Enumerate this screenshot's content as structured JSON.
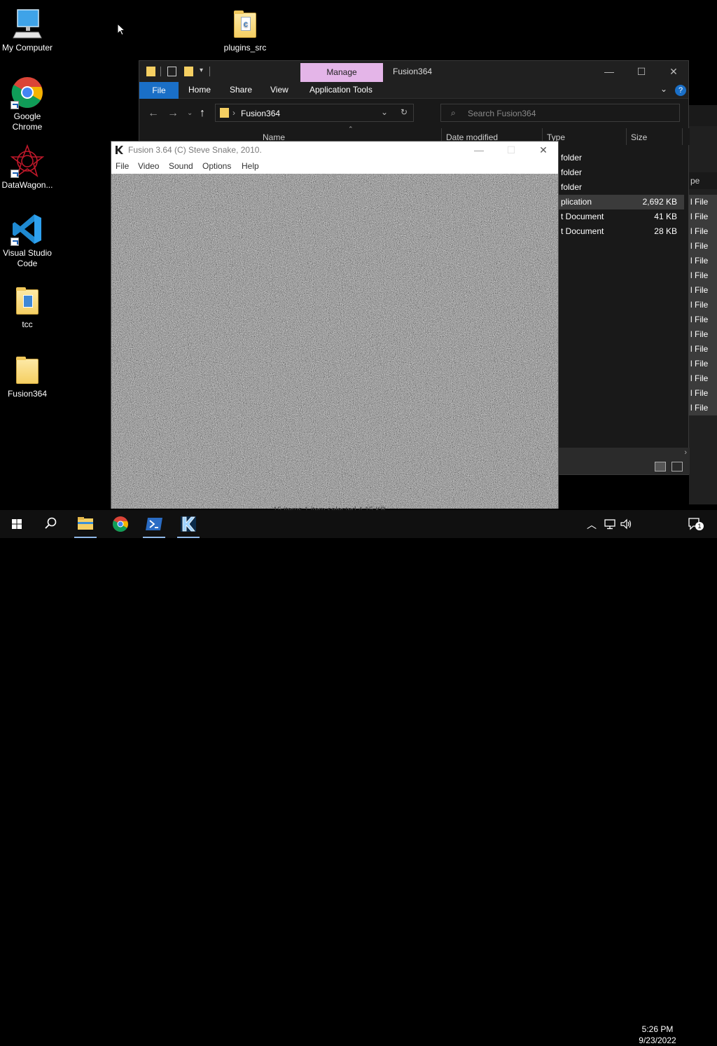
{
  "desktop": {
    "icons": [
      {
        "label": "My Computer"
      },
      {
        "label": "Google Chrome"
      },
      {
        "label": "DataWagon..."
      },
      {
        "label": "Visual Studio Code"
      },
      {
        "label": "tcc"
      },
      {
        "label": "Fusion364"
      },
      {
        "label": "plugins_src"
      }
    ]
  },
  "explorer": {
    "manage_tab": "Manage",
    "title": "Fusion364",
    "ribbon": {
      "file": "File",
      "home": "Home",
      "share": "Share",
      "view": "View",
      "app_tools": "Application Tools"
    },
    "address": "Fusion364",
    "search_placeholder": "Search Fusion364",
    "columns": {
      "name": "Name",
      "date": "Date modified",
      "type": "Type",
      "size": "Size"
    },
    "rows": [
      {
        "type": "folder",
        "size": ""
      },
      {
        "type": "folder",
        "size": ""
      },
      {
        "type": "folder",
        "size": ""
      },
      {
        "type": "plication",
        "size": "2,692 KB"
      },
      {
        "type": "t Document",
        "size": "41 KB"
      },
      {
        "type": "t Document",
        "size": "28 KB"
      }
    ]
  },
  "third_window": {
    "header": "pe",
    "row_label": "l File"
  },
  "fusion": {
    "title": "Fusion 3.64 (C) Steve Snake, 2010.",
    "menu": {
      "file": "File",
      "video": "Video",
      "sound": "Sound",
      "options": "Options",
      "help": "Help"
    }
  },
  "taskbar": {
    "time": "5:26 PM",
    "date": "9/23/2022",
    "notification_count": "1",
    "ghost_status": "15 items   1 item selected 4.15 KB"
  },
  "colors": {
    "accent_blue": "#1a6fc7",
    "manage_tab": "#e4b5e8",
    "explorer_bg": "#191919",
    "taskbar_bg": "#101010"
  }
}
